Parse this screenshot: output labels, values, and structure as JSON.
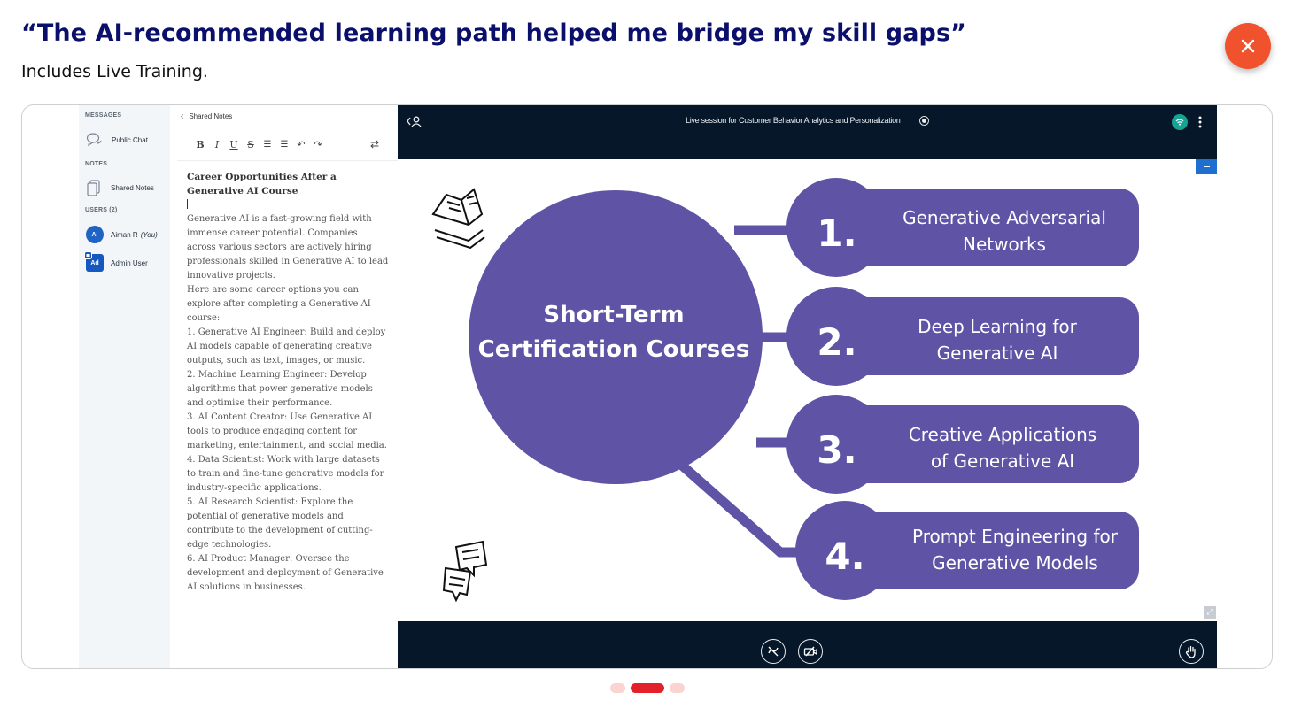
{
  "header": {
    "quote": "“The AI-recommended learning path helped me bridge my skill gaps”",
    "subtitle": "Includes Live Training.",
    "close_icon": "close-icon",
    "accent_color": "#f0522e",
    "title_color": "#0a0f6b"
  },
  "sidebar": {
    "messages_label": "MESSAGES",
    "public_chat": "Public Chat",
    "notes_label": "NOTES",
    "shared_notes": "Shared Notes",
    "users_label": "USERS (2)",
    "users": [
      {
        "initials": "AI",
        "name": "Aiman R",
        "tag": "(You)"
      },
      {
        "initials": "Ad",
        "name": "Admin User",
        "tag": ""
      }
    ]
  },
  "notes": {
    "back_label": "Shared Notes",
    "toolbar": [
      "bold",
      "italic",
      "underline",
      "strikethrough",
      "ordered-list",
      "bullet-list",
      "undo",
      "redo"
    ],
    "doc_title": "Career Opportunities After a Generative AI Course",
    "body": "Generative AI is a fast-growing field with immense career potential. Companies across various sectors are actively hiring professionals skilled in Generative AI to lead innovative projects.\nHere are some career options you can explore after completing a Generative AI course:\n1. Generative AI Engineer: Build and deploy AI models capable of generating creative outputs, such as text, images, or music.\n2. Machine Learning Engineer: Develop algorithms that power generative models and optimise their performance.\n3. AI Content Creator: Use Generative AI tools to produce engaging content for marketing, entertainment, and social media.\n4. Data Scientist: Work with large datasets to train and fine-tune generative models for industry-specific applications.\n5. AI Research Scientist: Explore the potential of generative models and contribute to the development of cutting-edge technologies.\n6. AI Product Manager: Oversee the development and deployment of Generative AI solutions in businesses."
  },
  "session": {
    "title": "Live session for Customer Behavior Analytics and Personalization"
  },
  "slide": {
    "center_line1": "Short-Term",
    "center_line2": "Certification Courses",
    "color": "#5f53a6",
    "items": [
      {
        "num": "1.",
        "line1": "Generative Adversarial",
        "line2": "Networks"
      },
      {
        "num": "2.",
        "line1": "Deep Learning for",
        "line2": "Generative AI"
      },
      {
        "num": "3.",
        "line1": "Creative Applications",
        "line2": "of Generative AI"
      },
      {
        "num": "4.",
        "line1": "Prompt Engineering for",
        "line2": "Generative Models"
      }
    ]
  },
  "controls": {
    "audio_icon": "mute-icon",
    "video_icon": "video-off-icon",
    "raise_hand_icon": "raise-hand-icon"
  },
  "carousel": {
    "total": 3,
    "active": 2
  }
}
